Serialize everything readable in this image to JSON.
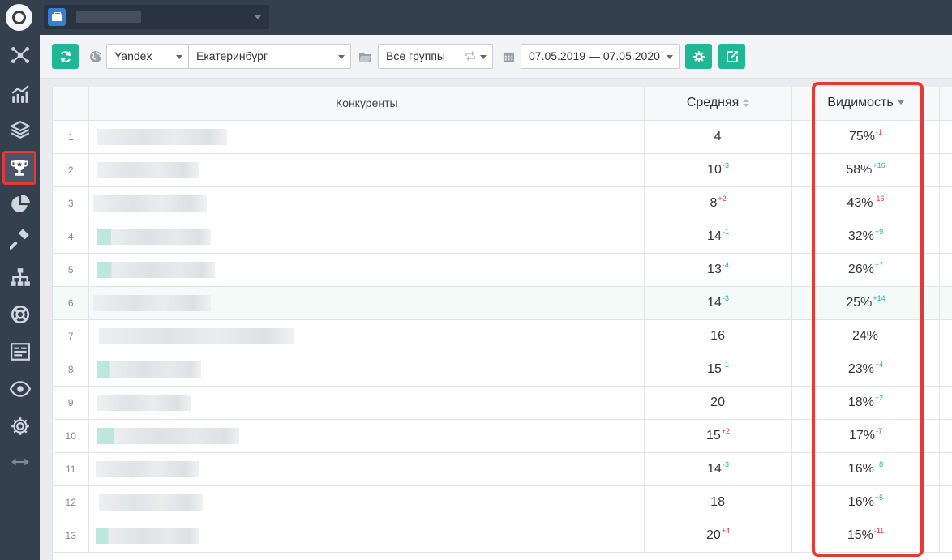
{
  "sidebar": {
    "items": [
      {
        "name": "network-icon"
      },
      {
        "name": "chart-icon"
      },
      {
        "name": "layers-icon"
      },
      {
        "name": "trophy-icon",
        "active": true
      },
      {
        "name": "pie-chart-icon"
      },
      {
        "name": "hammer-icon"
      },
      {
        "name": "sitemap-icon"
      },
      {
        "name": "lifebuoy-icon"
      },
      {
        "name": "report-icon"
      },
      {
        "name": "eye-icon"
      },
      {
        "name": "settings-icon"
      },
      {
        "name": "expand-icon"
      }
    ]
  },
  "toolbar": {
    "search_engine": "Yandex",
    "region": "Екатеринбург",
    "groups": "Все группы",
    "date_range": "07.05.2019 — 07.05.2020"
  },
  "table": {
    "headers": {
      "competitors": "Конкуренты",
      "average": "Средняя",
      "visibility": "Видимость"
    },
    "rows": [
      {
        "n": "1",
        "avg": "4",
        "avg_d": "",
        "avg_dir": "",
        "vis": "75%",
        "vis_d": "-1",
        "vis_dir": "down"
      },
      {
        "n": "2",
        "avg": "10",
        "avg_d": "-3",
        "avg_dir": "up",
        "vis": "58%",
        "vis_d": "+16",
        "vis_dir": "up"
      },
      {
        "n": "3",
        "avg": "8",
        "avg_d": "+2",
        "avg_dir": "down",
        "vis": "43%",
        "vis_d": "-16",
        "vis_dir": "down"
      },
      {
        "n": "4",
        "avg": "14",
        "avg_d": "-1",
        "avg_dir": "up",
        "vis": "32%",
        "vis_d": "+9",
        "vis_dir": "up"
      },
      {
        "n": "5",
        "avg": "13",
        "avg_d": "-4",
        "avg_dir": "up",
        "vis": "26%",
        "vis_d": "+7",
        "vis_dir": "up"
      },
      {
        "n": "6",
        "avg": "14",
        "avg_d": "-3",
        "avg_dir": "up",
        "vis": "25%",
        "vis_d": "+14",
        "vis_dir": "up"
      },
      {
        "n": "7",
        "avg": "16",
        "avg_d": "",
        "avg_dir": "",
        "vis": "24%",
        "vis_d": "",
        "vis_dir": ""
      },
      {
        "n": "8",
        "avg": "15",
        "avg_d": "-1",
        "avg_dir": "up",
        "vis": "23%",
        "vis_d": "+4",
        "vis_dir": "up"
      },
      {
        "n": "9",
        "avg": "20",
        "avg_d": "",
        "avg_dir": "",
        "vis": "18%",
        "vis_d": "+2",
        "vis_dir": "up"
      },
      {
        "n": "10",
        "avg": "15",
        "avg_d": "+2",
        "avg_dir": "down",
        "vis": "17%",
        "vis_d": "-7",
        "vis_dir": "down"
      },
      {
        "n": "11",
        "avg": "14",
        "avg_d": "-3",
        "avg_dir": "up",
        "vis": "16%",
        "vis_d": "+8",
        "vis_dir": "up"
      },
      {
        "n": "12",
        "avg": "18",
        "avg_d": "",
        "avg_dir": "",
        "vis": "16%",
        "vis_d": "+5",
        "vis_dir": "up"
      },
      {
        "n": "13",
        "avg": "20",
        "avg_d": "+4",
        "avg_dir": "down",
        "vis": "15%",
        "vis_d": "-11",
        "vis_dir": "down"
      }
    ]
  },
  "colors": {
    "accent": "#1fb896",
    "negative": "#e53935",
    "sidebar": "#35404f"
  }
}
